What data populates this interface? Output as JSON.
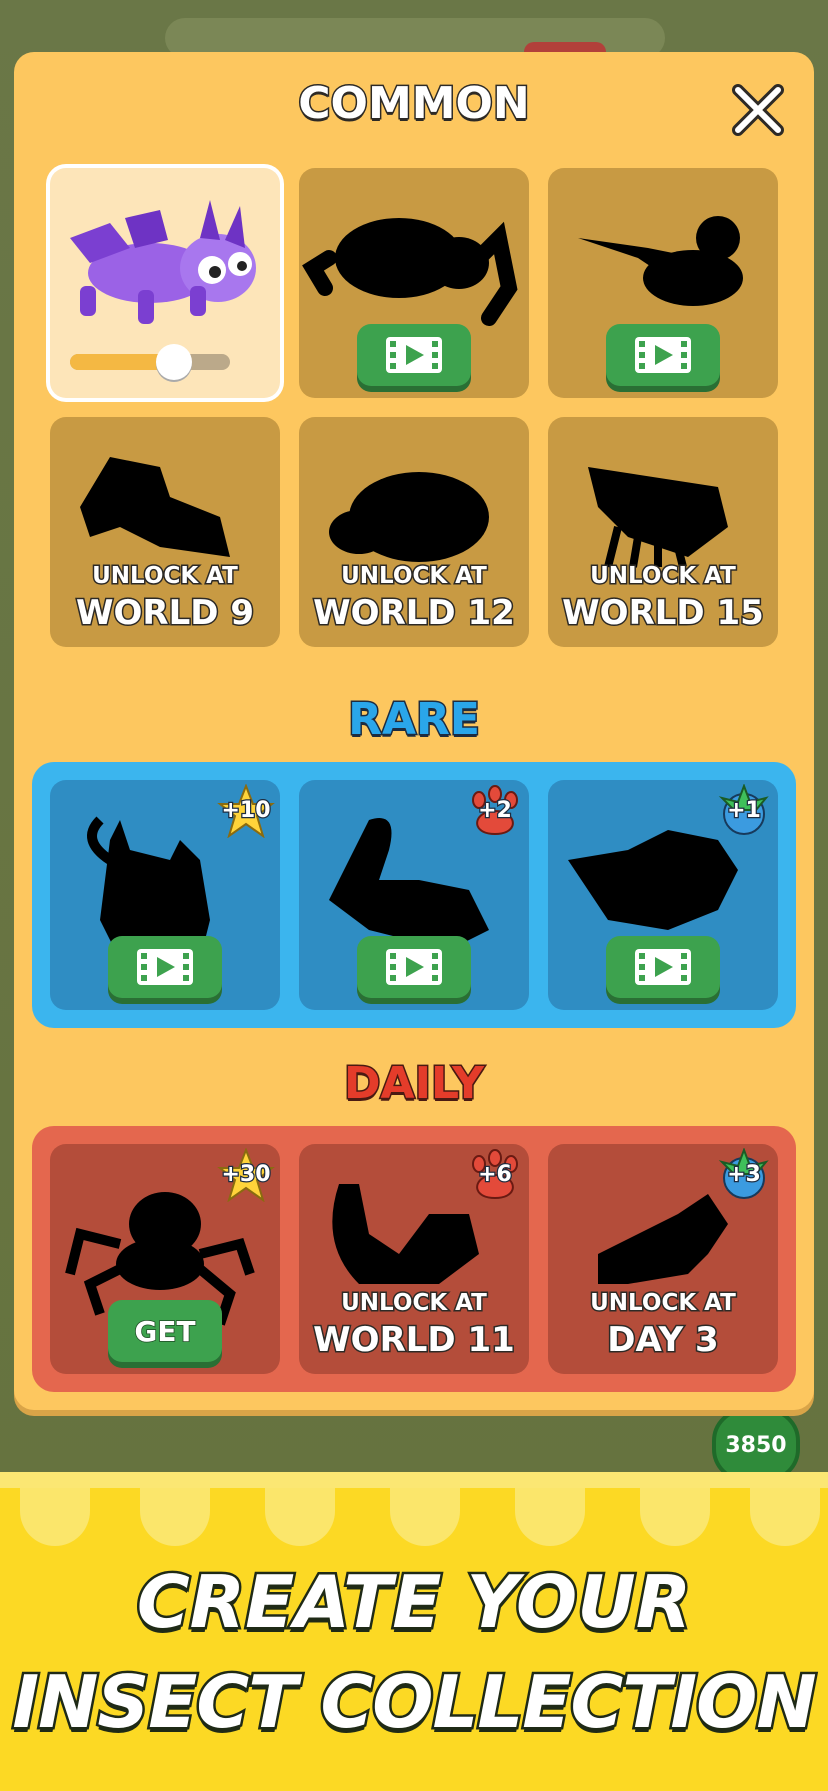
{
  "popup": {
    "close_icon": "close-x-icon",
    "sections": {
      "common": {
        "title": "COMMON"
      },
      "rare": {
        "title": "RARE"
      },
      "daily": {
        "title": "DAILY"
      }
    }
  },
  "common": {
    "selected": {
      "name": "purple-dragon-bug",
      "slider_fraction": 0.65
    },
    "cell2": {
      "action_icon": "video-play-icon"
    },
    "cell3": {
      "action_icon": "video-play-icon"
    },
    "cell4": {
      "unlock_label": "UNLOCK AT",
      "unlock_value": "WORLD 9"
    },
    "cell5": {
      "unlock_label": "UNLOCK AT",
      "unlock_value": "WORLD 12"
    },
    "cell6": {
      "unlock_label": "UNLOCK AT",
      "unlock_value": "WORLD 15"
    }
  },
  "rare": {
    "cell1": {
      "badge": "+10",
      "badge_icon": "star-icon",
      "action_icon": "video-play-icon"
    },
    "cell2": {
      "badge": "+2",
      "badge_icon": "paw-icon",
      "action_icon": "video-play-icon"
    },
    "cell3": {
      "badge": "+1",
      "badge_icon": "gem-icon",
      "action_icon": "video-play-icon"
    }
  },
  "daily": {
    "cell1": {
      "badge": "+30",
      "badge_icon": "star-icon",
      "button": "GET"
    },
    "cell2": {
      "badge": "+6",
      "badge_icon": "paw-icon",
      "unlock_label": "UNLOCK AT",
      "unlock_value": "WORLD 11"
    },
    "cell3": {
      "badge": "+3",
      "badge_icon": "gem-icon",
      "unlock_label": "UNLOCK AT",
      "unlock_value": "DAY 3"
    }
  },
  "background": {
    "coin_value": "3850"
  },
  "banner": {
    "line1": "CREATE YOUR",
    "line2": "INSECT COLLECTION"
  },
  "colors": {
    "panel": "#fdc75f",
    "rare": "#3bb5ee",
    "daily": "#e4674e",
    "play_button": "#3da24e",
    "banner": "#fcd924"
  }
}
